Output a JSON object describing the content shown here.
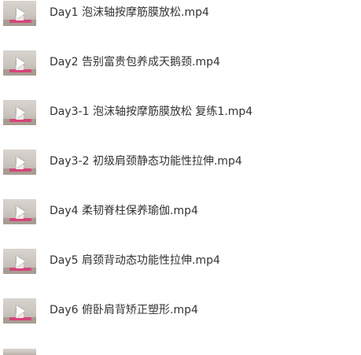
{
  "files": [
    {
      "name": "Day1 泡沫轴按摩筋膜放松.mp4",
      "thumbnail": "video-thumbnail"
    },
    {
      "name": "Day2 告别富贵包养成天鹅颈.mp4",
      "thumbnail": "video-thumbnail"
    },
    {
      "name": "Day3-1 泡沫轴按摩筋膜放松 复练1.mp4",
      "thumbnail": "video-thumbnail"
    },
    {
      "name": "Day3-2 初级肩颈静态功能性拉伸.mp4",
      "thumbnail": "video-thumbnail"
    },
    {
      "name": "Day4 柔韧脊柱保养瑜伽.mp4",
      "thumbnail": "video-thumbnail"
    },
    {
      "name": "Day5 肩颈背动态功能性拉伸.mp4",
      "thumbnail": "video-thumbnail"
    },
    {
      "name": "Day6 俯卧肩背矫正塑形.mp4",
      "thumbnail": "video-thumbnail"
    }
  ],
  "colors": {
    "mat": "#d6457a",
    "text": "#333333"
  },
  "icons": {
    "play": "play-icon"
  }
}
